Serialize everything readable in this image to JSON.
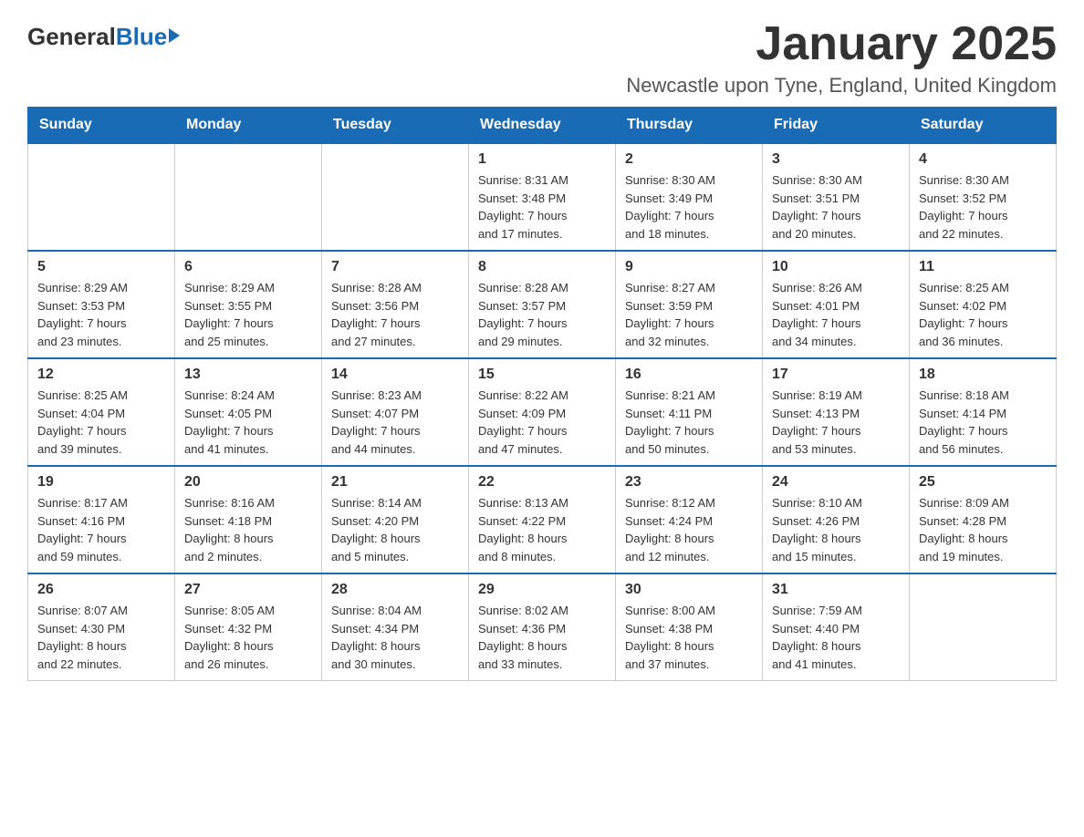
{
  "logo": {
    "general": "General",
    "blue": "Blue"
  },
  "title": "January 2025",
  "subtitle": "Newcastle upon Tyne, England, United Kingdom",
  "days_of_week": [
    "Sunday",
    "Monday",
    "Tuesday",
    "Wednesday",
    "Thursday",
    "Friday",
    "Saturday"
  ],
  "weeks": [
    [
      {
        "day": "",
        "info": ""
      },
      {
        "day": "",
        "info": ""
      },
      {
        "day": "",
        "info": ""
      },
      {
        "day": "1",
        "info": "Sunrise: 8:31 AM\nSunset: 3:48 PM\nDaylight: 7 hours\nand 17 minutes."
      },
      {
        "day": "2",
        "info": "Sunrise: 8:30 AM\nSunset: 3:49 PM\nDaylight: 7 hours\nand 18 minutes."
      },
      {
        "day": "3",
        "info": "Sunrise: 8:30 AM\nSunset: 3:51 PM\nDaylight: 7 hours\nand 20 minutes."
      },
      {
        "day": "4",
        "info": "Sunrise: 8:30 AM\nSunset: 3:52 PM\nDaylight: 7 hours\nand 22 minutes."
      }
    ],
    [
      {
        "day": "5",
        "info": "Sunrise: 8:29 AM\nSunset: 3:53 PM\nDaylight: 7 hours\nand 23 minutes."
      },
      {
        "day": "6",
        "info": "Sunrise: 8:29 AM\nSunset: 3:55 PM\nDaylight: 7 hours\nand 25 minutes."
      },
      {
        "day": "7",
        "info": "Sunrise: 8:28 AM\nSunset: 3:56 PM\nDaylight: 7 hours\nand 27 minutes."
      },
      {
        "day": "8",
        "info": "Sunrise: 8:28 AM\nSunset: 3:57 PM\nDaylight: 7 hours\nand 29 minutes."
      },
      {
        "day": "9",
        "info": "Sunrise: 8:27 AM\nSunset: 3:59 PM\nDaylight: 7 hours\nand 32 minutes."
      },
      {
        "day": "10",
        "info": "Sunrise: 8:26 AM\nSunset: 4:01 PM\nDaylight: 7 hours\nand 34 minutes."
      },
      {
        "day": "11",
        "info": "Sunrise: 8:25 AM\nSunset: 4:02 PM\nDaylight: 7 hours\nand 36 minutes."
      }
    ],
    [
      {
        "day": "12",
        "info": "Sunrise: 8:25 AM\nSunset: 4:04 PM\nDaylight: 7 hours\nand 39 minutes."
      },
      {
        "day": "13",
        "info": "Sunrise: 8:24 AM\nSunset: 4:05 PM\nDaylight: 7 hours\nand 41 minutes."
      },
      {
        "day": "14",
        "info": "Sunrise: 8:23 AM\nSunset: 4:07 PM\nDaylight: 7 hours\nand 44 minutes."
      },
      {
        "day": "15",
        "info": "Sunrise: 8:22 AM\nSunset: 4:09 PM\nDaylight: 7 hours\nand 47 minutes."
      },
      {
        "day": "16",
        "info": "Sunrise: 8:21 AM\nSunset: 4:11 PM\nDaylight: 7 hours\nand 50 minutes."
      },
      {
        "day": "17",
        "info": "Sunrise: 8:19 AM\nSunset: 4:13 PM\nDaylight: 7 hours\nand 53 minutes."
      },
      {
        "day": "18",
        "info": "Sunrise: 8:18 AM\nSunset: 4:14 PM\nDaylight: 7 hours\nand 56 minutes."
      }
    ],
    [
      {
        "day": "19",
        "info": "Sunrise: 8:17 AM\nSunset: 4:16 PM\nDaylight: 7 hours\nand 59 minutes."
      },
      {
        "day": "20",
        "info": "Sunrise: 8:16 AM\nSunset: 4:18 PM\nDaylight: 8 hours\nand 2 minutes."
      },
      {
        "day": "21",
        "info": "Sunrise: 8:14 AM\nSunset: 4:20 PM\nDaylight: 8 hours\nand 5 minutes."
      },
      {
        "day": "22",
        "info": "Sunrise: 8:13 AM\nSunset: 4:22 PM\nDaylight: 8 hours\nand 8 minutes."
      },
      {
        "day": "23",
        "info": "Sunrise: 8:12 AM\nSunset: 4:24 PM\nDaylight: 8 hours\nand 12 minutes."
      },
      {
        "day": "24",
        "info": "Sunrise: 8:10 AM\nSunset: 4:26 PM\nDaylight: 8 hours\nand 15 minutes."
      },
      {
        "day": "25",
        "info": "Sunrise: 8:09 AM\nSunset: 4:28 PM\nDaylight: 8 hours\nand 19 minutes."
      }
    ],
    [
      {
        "day": "26",
        "info": "Sunrise: 8:07 AM\nSunset: 4:30 PM\nDaylight: 8 hours\nand 22 minutes."
      },
      {
        "day": "27",
        "info": "Sunrise: 8:05 AM\nSunset: 4:32 PM\nDaylight: 8 hours\nand 26 minutes."
      },
      {
        "day": "28",
        "info": "Sunrise: 8:04 AM\nSunset: 4:34 PM\nDaylight: 8 hours\nand 30 minutes."
      },
      {
        "day": "29",
        "info": "Sunrise: 8:02 AM\nSunset: 4:36 PM\nDaylight: 8 hours\nand 33 minutes."
      },
      {
        "day": "30",
        "info": "Sunrise: 8:00 AM\nSunset: 4:38 PM\nDaylight: 8 hours\nand 37 minutes."
      },
      {
        "day": "31",
        "info": "Sunrise: 7:59 AM\nSunset: 4:40 PM\nDaylight: 8 hours\nand 41 minutes."
      },
      {
        "day": "",
        "info": ""
      }
    ]
  ]
}
